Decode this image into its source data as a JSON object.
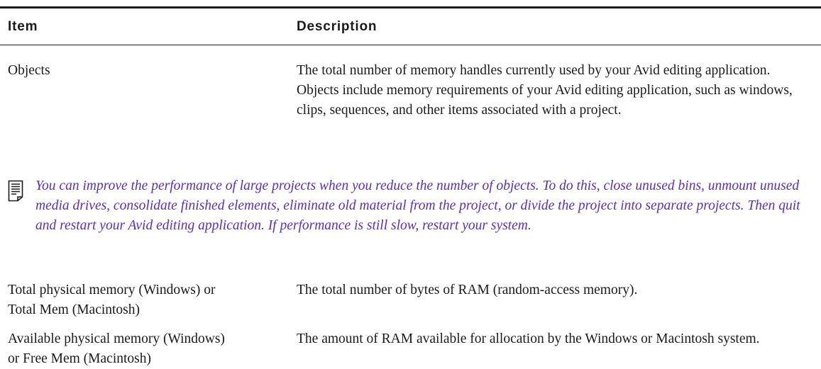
{
  "table": {
    "header": {
      "item": "Item",
      "description": "Description"
    },
    "rows": [
      {
        "item": "Objects",
        "description": "The total number of memory handles currently used by your Avid editing application. Objects include memory requirements of your Avid editing application, such as windows, clips, sequences, and other items associated with a project."
      },
      {
        "item_line1": "Total physical memory (Windows) or",
        "item_line2": "Total Mem (Macintosh)",
        "description": "The total number of bytes of RAM (random-access memory)."
      },
      {
        "item_line1": "Available physical memory (Windows)",
        "item_line2": "or Free Mem (Macintosh)",
        "description": "The amount of RAM available for allocation by the Windows or Macintosh system."
      }
    ]
  },
  "note": {
    "icon": "note-icon",
    "text": "You can improve the performance of large projects when you reduce the number of objects. To do this, close unused bins, unmount unused media drives, consolidate finished elements, eliminate old material from the project, or divide the project into separate projects. Then quit and restart your Avid editing application. If performance is still slow, restart your system."
  },
  "colors": {
    "text": "#1a1a1a",
    "note": "#5b2ec2"
  }
}
